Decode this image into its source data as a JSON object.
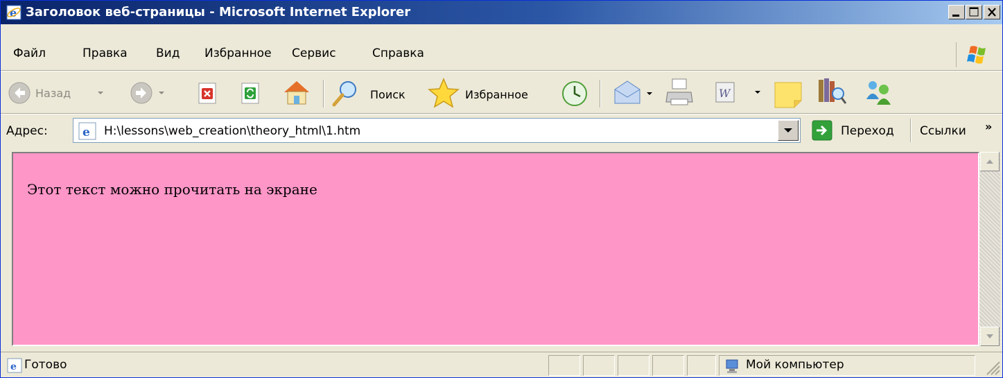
{
  "window": {
    "title": "Заголовок веб-страницы - Microsoft Internet Explorer"
  },
  "menu": {
    "items": [
      "Файл",
      "Правка",
      "Вид",
      "Избранное",
      "Сервис",
      "Справка"
    ]
  },
  "toolbar": {
    "back_label": "Назад",
    "search_label": "Поиск",
    "favorites_label": "Избранное"
  },
  "address": {
    "label": "Адрес:",
    "url": "H:\\lessons\\web_creation\\theory_html\\1.htm",
    "go_label": "Переход",
    "links_label": "Ссылки"
  },
  "page": {
    "text": "Этот текст можно прочитать на экране",
    "background": "#FF96C8"
  },
  "status": {
    "text": "Готово",
    "zone": "Мой компьютер"
  }
}
